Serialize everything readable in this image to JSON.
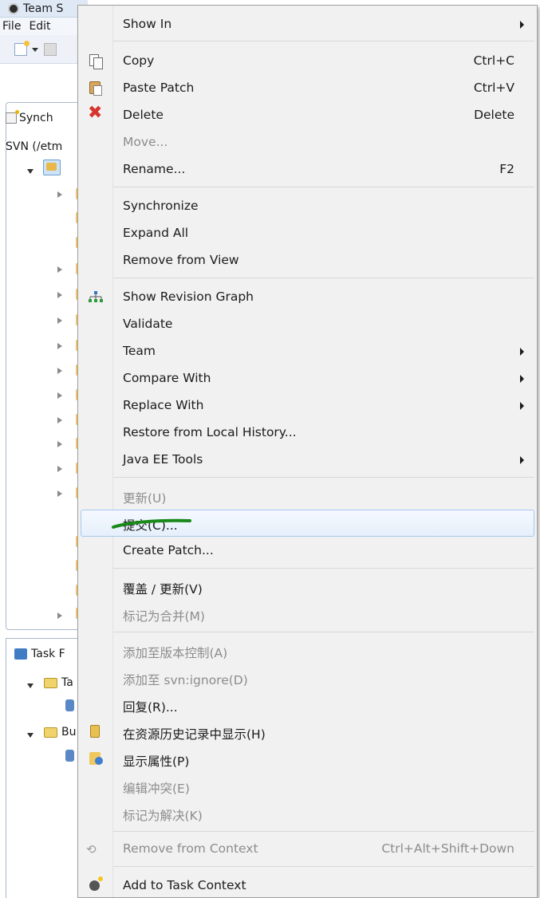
{
  "window": {
    "title": "Team S",
    "menus": [
      "File",
      "Edit"
    ]
  },
  "sync_view": {
    "tab_label": "Synch",
    "repo_label": "SVN (/etm"
  },
  "task_view": {
    "tab_label": "Task F",
    "folder_1": "Ta",
    "folder_2": "Bu"
  },
  "context_menu": {
    "show_in": "Show In",
    "copy": "Copy",
    "copy_shortcut": "Ctrl+C",
    "paste_patch": "Paste Patch",
    "paste_shortcut": "Ctrl+V",
    "delete": "Delete",
    "delete_shortcut": "Delete",
    "move": "Move...",
    "rename": "Rename...",
    "rename_shortcut": "F2",
    "synchronize": "Synchronize",
    "expand_all": "Expand All",
    "remove_from_view": "Remove from View",
    "show_revision_graph": "Show Revision Graph",
    "validate": "Validate",
    "team": "Team",
    "compare_with": "Compare With",
    "replace_with": "Replace With",
    "restore_history": "Restore from Local History...",
    "java_ee_tools": "Java EE Tools",
    "update": "更新(U)",
    "commit": "提交(C)...",
    "create_patch": "Create Patch...",
    "override_update": "覆盖 / 更新(V)",
    "mark_merged": "标记为合并(M)",
    "add_version_control": "添加至版本控制(A)",
    "add_svn_ignore": "添加至 svn:ignore(D)",
    "revert": "回复(R)...",
    "show_history": "在资源历史记录中显示(H)",
    "show_properties": "显示属性(P)",
    "edit_conflicts": "编辑冲突(E)",
    "mark_resolved": "标记为解决(K)",
    "remove_context": "Remove from Context",
    "remove_context_shortcut": "Ctrl+Alt+Shift+Down",
    "add_task_context": "Add to Task Context"
  },
  "colors": {
    "menu_bg": "#f1f1f1",
    "hover_border": "#a7c7ef",
    "annotation_green": "#1a8a1a",
    "delete_red": "#d6342d"
  }
}
